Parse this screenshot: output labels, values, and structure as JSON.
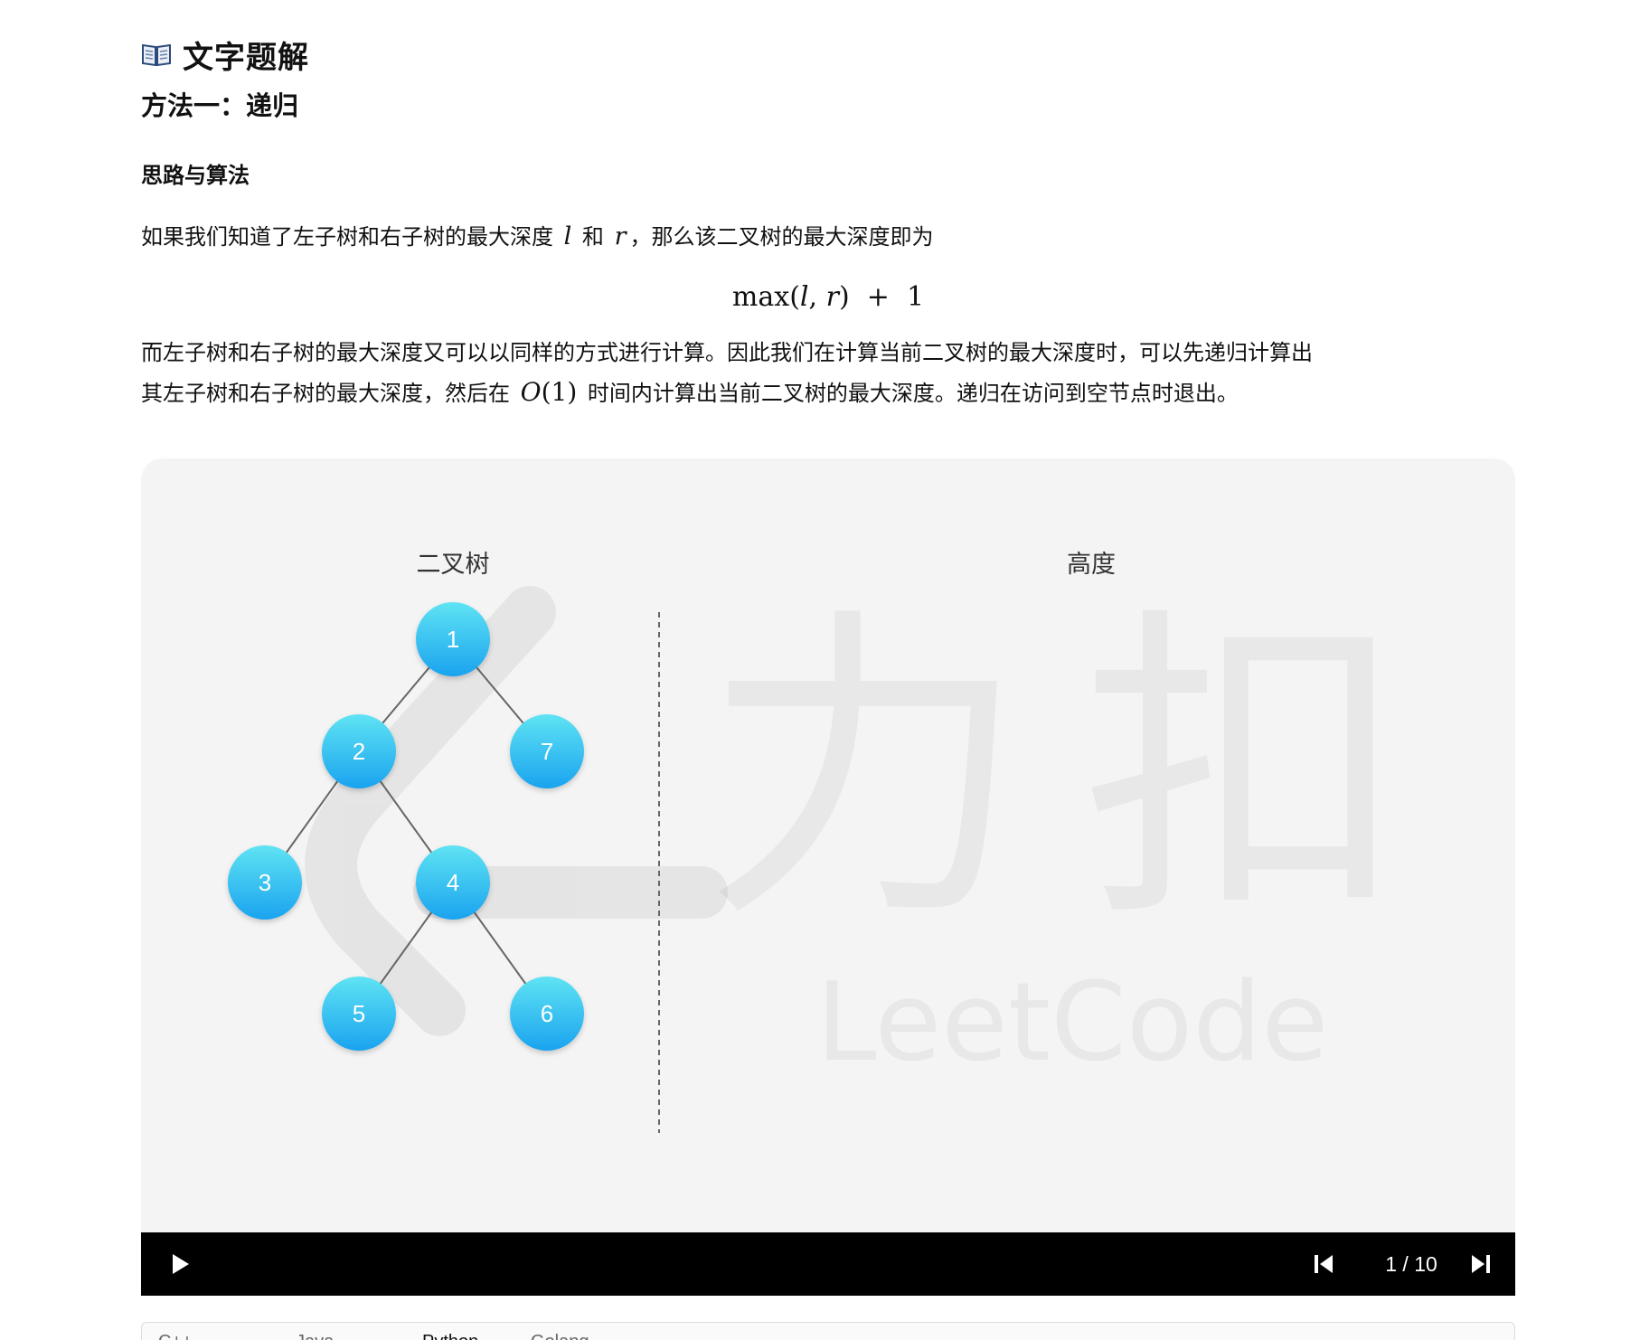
{
  "header": {
    "title": "文字题解",
    "book_icon": "open-book-icon"
  },
  "method": {
    "title": "方法一：递归"
  },
  "section": {
    "heading": "思路与算法"
  },
  "paragraph1": {
    "text_a": "如果我们知道了左子树和右子树的最大深度",
    "var_l": "l",
    "text_b": "和",
    "var_r": "r",
    "text_c": "，那么该二叉树的最大深度即为"
  },
  "formula": {
    "func": "max",
    "open": "(",
    "arg1": "l",
    "comma": ",",
    "arg2": "r",
    "close": ")",
    "plus": "+",
    "one": "1"
  },
  "paragraph2": {
    "line1": "而左子树和右子树的最大深度又可以以同样的方式进行计算。因此我们在计算当前二叉树的最大深度时，可以先递归计算出",
    "line2_a": "其左子树和右子树的最大深度，然后在",
    "o_letter": "O",
    "o_arg": "(1)",
    "line2_b": "时间内计算出当前二叉树的最大深度。递归在访问到空节点时退出。"
  },
  "viewer": {
    "left_label": "二叉树",
    "right_label": "高度",
    "watermark_cn": "力扣",
    "watermark_en": "LeetCode",
    "node_color_top": "#5fe3f3",
    "node_color_bottom": "#1aa3ef",
    "background": "#f4f4f4",
    "tree": {
      "nodes": [
        {
          "id": "1",
          "label": "1"
        },
        {
          "id": "2",
          "label": "2"
        },
        {
          "id": "7",
          "label": "7"
        },
        {
          "id": "3",
          "label": "3"
        },
        {
          "id": "4",
          "label": "4"
        },
        {
          "id": "5",
          "label": "5"
        },
        {
          "id": "6",
          "label": "6"
        }
      ],
      "edges": [
        [
          "1",
          "2"
        ],
        [
          "1",
          "7"
        ],
        [
          "2",
          "3"
        ],
        [
          "2",
          "4"
        ],
        [
          "4",
          "5"
        ],
        [
          "4",
          "6"
        ]
      ]
    }
  },
  "controls": {
    "play_icon": "play-icon",
    "prev_icon": "skip-previous-icon",
    "next_icon": "skip-next-icon",
    "current_page": "1",
    "separator": "/",
    "total_pages": "10"
  },
  "code_tabs": {
    "items": [
      "C++",
      "Java",
      "Python",
      "Golang"
    ]
  }
}
